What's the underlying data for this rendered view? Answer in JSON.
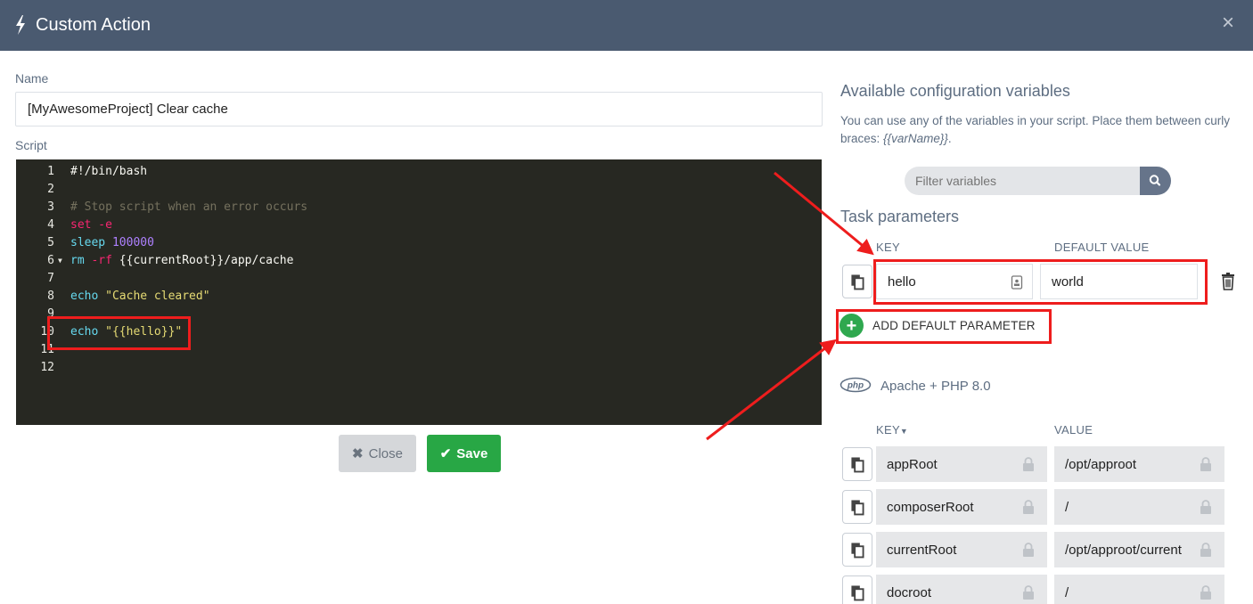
{
  "header": {
    "title": "Custom Action",
    "close_symbol": "×",
    "icon": "bolt-icon"
  },
  "form": {
    "name_label": "Name",
    "name_value": "[MyAwesomeProject] Clear cache",
    "script_label": "Script"
  },
  "script": {
    "line_numbers": [
      "1",
      "2",
      "3",
      "4",
      "5",
      "6",
      "7",
      "8",
      "9",
      "10",
      "11",
      "12"
    ],
    "lines": {
      "l1": "#!/bin/bash",
      "l3": "# Stop script when an error occurs",
      "l4_kw": "set",
      "l4_rest": " -e",
      "l5_fn": "sleep",
      "l5_num": " 100000",
      "l6_fn": "rm",
      "l6_flag": " -rf",
      "l6_rest": " {{currentRoot}}/app/cache",
      "l8_fn": "echo",
      "l8_str": " \"Cache cleared\"",
      "l10_fn": "echo",
      "l10_str": " \"{{hello}}\""
    }
  },
  "buttons": {
    "close_label": "Close",
    "save_label": "Save"
  },
  "variables": {
    "heading": "Available configuration variables",
    "help_text": "You can use any of the variables in your script. Place them between curly braces:",
    "help_example": "{{varName}}",
    "help_end": ".",
    "filter_placeholder": "Filter variables"
  },
  "task_parameters": {
    "heading": "Task parameters",
    "key_header": "KEY",
    "default_header": "DEFAULT VALUE",
    "rows": [
      {
        "key": "hello",
        "value": "world"
      }
    ],
    "add_label": "ADD DEFAULT PARAMETER"
  },
  "environment": {
    "logo_text": "php",
    "name": "Apache + PHP 8.0",
    "key_header": "KEY",
    "value_header": "VALUE",
    "rows": [
      {
        "key": "appRoot",
        "value": "/opt/approot"
      },
      {
        "key": "composerRoot",
        "value": "/"
      },
      {
        "key": "currentRoot",
        "value": "/opt/approot/current"
      },
      {
        "key": "docroot",
        "value": "/"
      }
    ]
  },
  "colors": {
    "header_bg": "#4a5a70",
    "editor_bg": "#272822",
    "save_green": "#28a745",
    "annotation_red": "#ee1d1d"
  }
}
